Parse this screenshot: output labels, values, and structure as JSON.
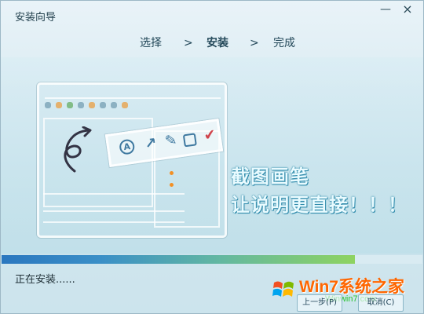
{
  "window": {
    "title": "安装向导",
    "minimize_label": "—",
    "close_label": "×"
  },
  "steps": [
    {
      "label": "选择"
    },
    {
      "label": "安装"
    },
    {
      "label": "完成"
    }
  ],
  "separators": [
    ">",
    ">"
  ],
  "promo": {
    "line1": "截图画笔",
    "line2": "让说明更直接！！！"
  },
  "progress": {
    "fraction": 0.84
  },
  "status": {
    "text": "正在安装......"
  },
  "buttons": {
    "previous": "上一步(P)",
    "cancel": "取消(C)"
  },
  "watermark": {
    "brand": "Win7系统之家",
    "site": "Winwin7.com"
  },
  "colors": {
    "accent": "#2a77bf",
    "progress_end": "#8ed360",
    "brand_orange": "#ff6600",
    "brand_green": "#28c42d"
  }
}
